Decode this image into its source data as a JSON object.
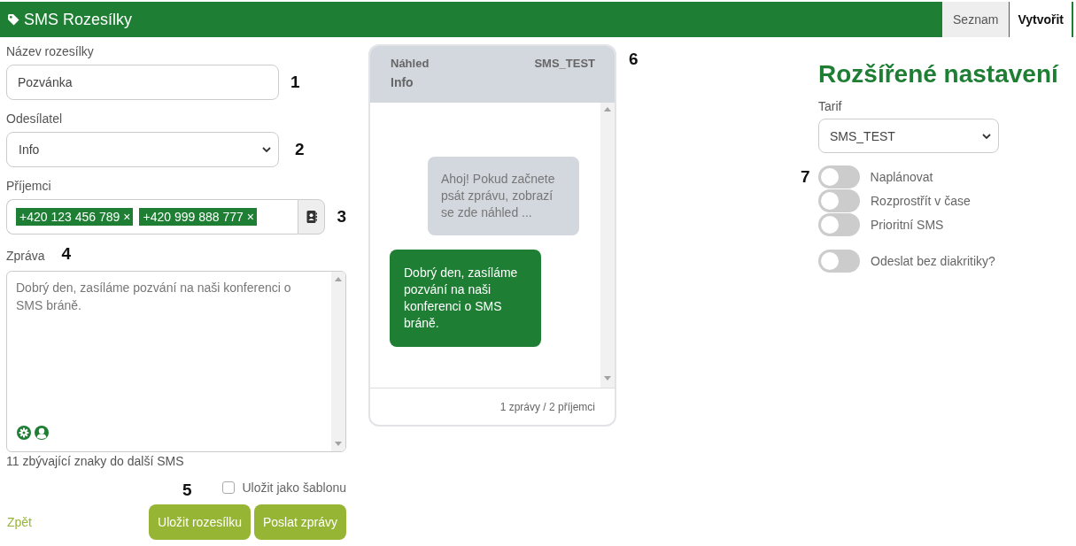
{
  "header": {
    "title": "SMS Rozesílky",
    "tabs": [
      {
        "label": "Seznam",
        "selected": false
      },
      {
        "label": "Vytvořit",
        "selected": true
      }
    ]
  },
  "form": {
    "name": {
      "label": "Název rozesílky",
      "value": "Pozvánka",
      "callout": "1"
    },
    "sender": {
      "label": "Odesílatel",
      "value": "Info",
      "callout": "2"
    },
    "recipients": {
      "label": "Příjemci",
      "tags": [
        {
          "text": "+420 123 456 789",
          "remove": "×"
        },
        {
          "text": "+420 999 888 777",
          "remove": "×"
        }
      ],
      "callout": "3"
    },
    "message": {
      "label": "Zpráva",
      "value": "Dobrý den, zasíláme pozvání na naši konferenci o SMS bráně.",
      "callout": "4",
      "counter": "11 zbývající znaky do další SMS"
    },
    "save_template": {
      "label": "Uložit jako šablonu",
      "checked": false,
      "callout": "5"
    },
    "back_link": "Zpět",
    "buttons": [
      {
        "label": "Uložit rozesílku"
      },
      {
        "label": "Poslat zprávy"
      }
    ]
  },
  "preview": {
    "title": "Náhled",
    "tariff": "SMS_TEST",
    "sender": "Info",
    "callout": "6",
    "messages": [
      {
        "kind": "hint",
        "text": "Ahoj! Pokud začnete psát zprávu, zobrazí se zde náhled ..."
      },
      {
        "kind": "message",
        "text": "Dobrý den, zasíláme pozvání na naši konferenci o SMS bráně."
      }
    ],
    "footer": "1 zprávy / 2 příjemci"
  },
  "advanced": {
    "title": "Rozšířené nastavení",
    "tariff": {
      "label": "Tarif",
      "value": "SMS_TEST"
    },
    "callout": "7",
    "toggle_groups": [
      {
        "toggles": [
          {
            "label": "Naplánovat",
            "on": false
          },
          {
            "label": "Rozprostřít v čase",
            "on": false
          },
          {
            "label": "Prioritní SMS",
            "on": false
          }
        ]
      },
      {
        "toggles": [
          {
            "label": "Odeslat bez diakritiky?",
            "on": false
          }
        ]
      }
    ]
  }
}
